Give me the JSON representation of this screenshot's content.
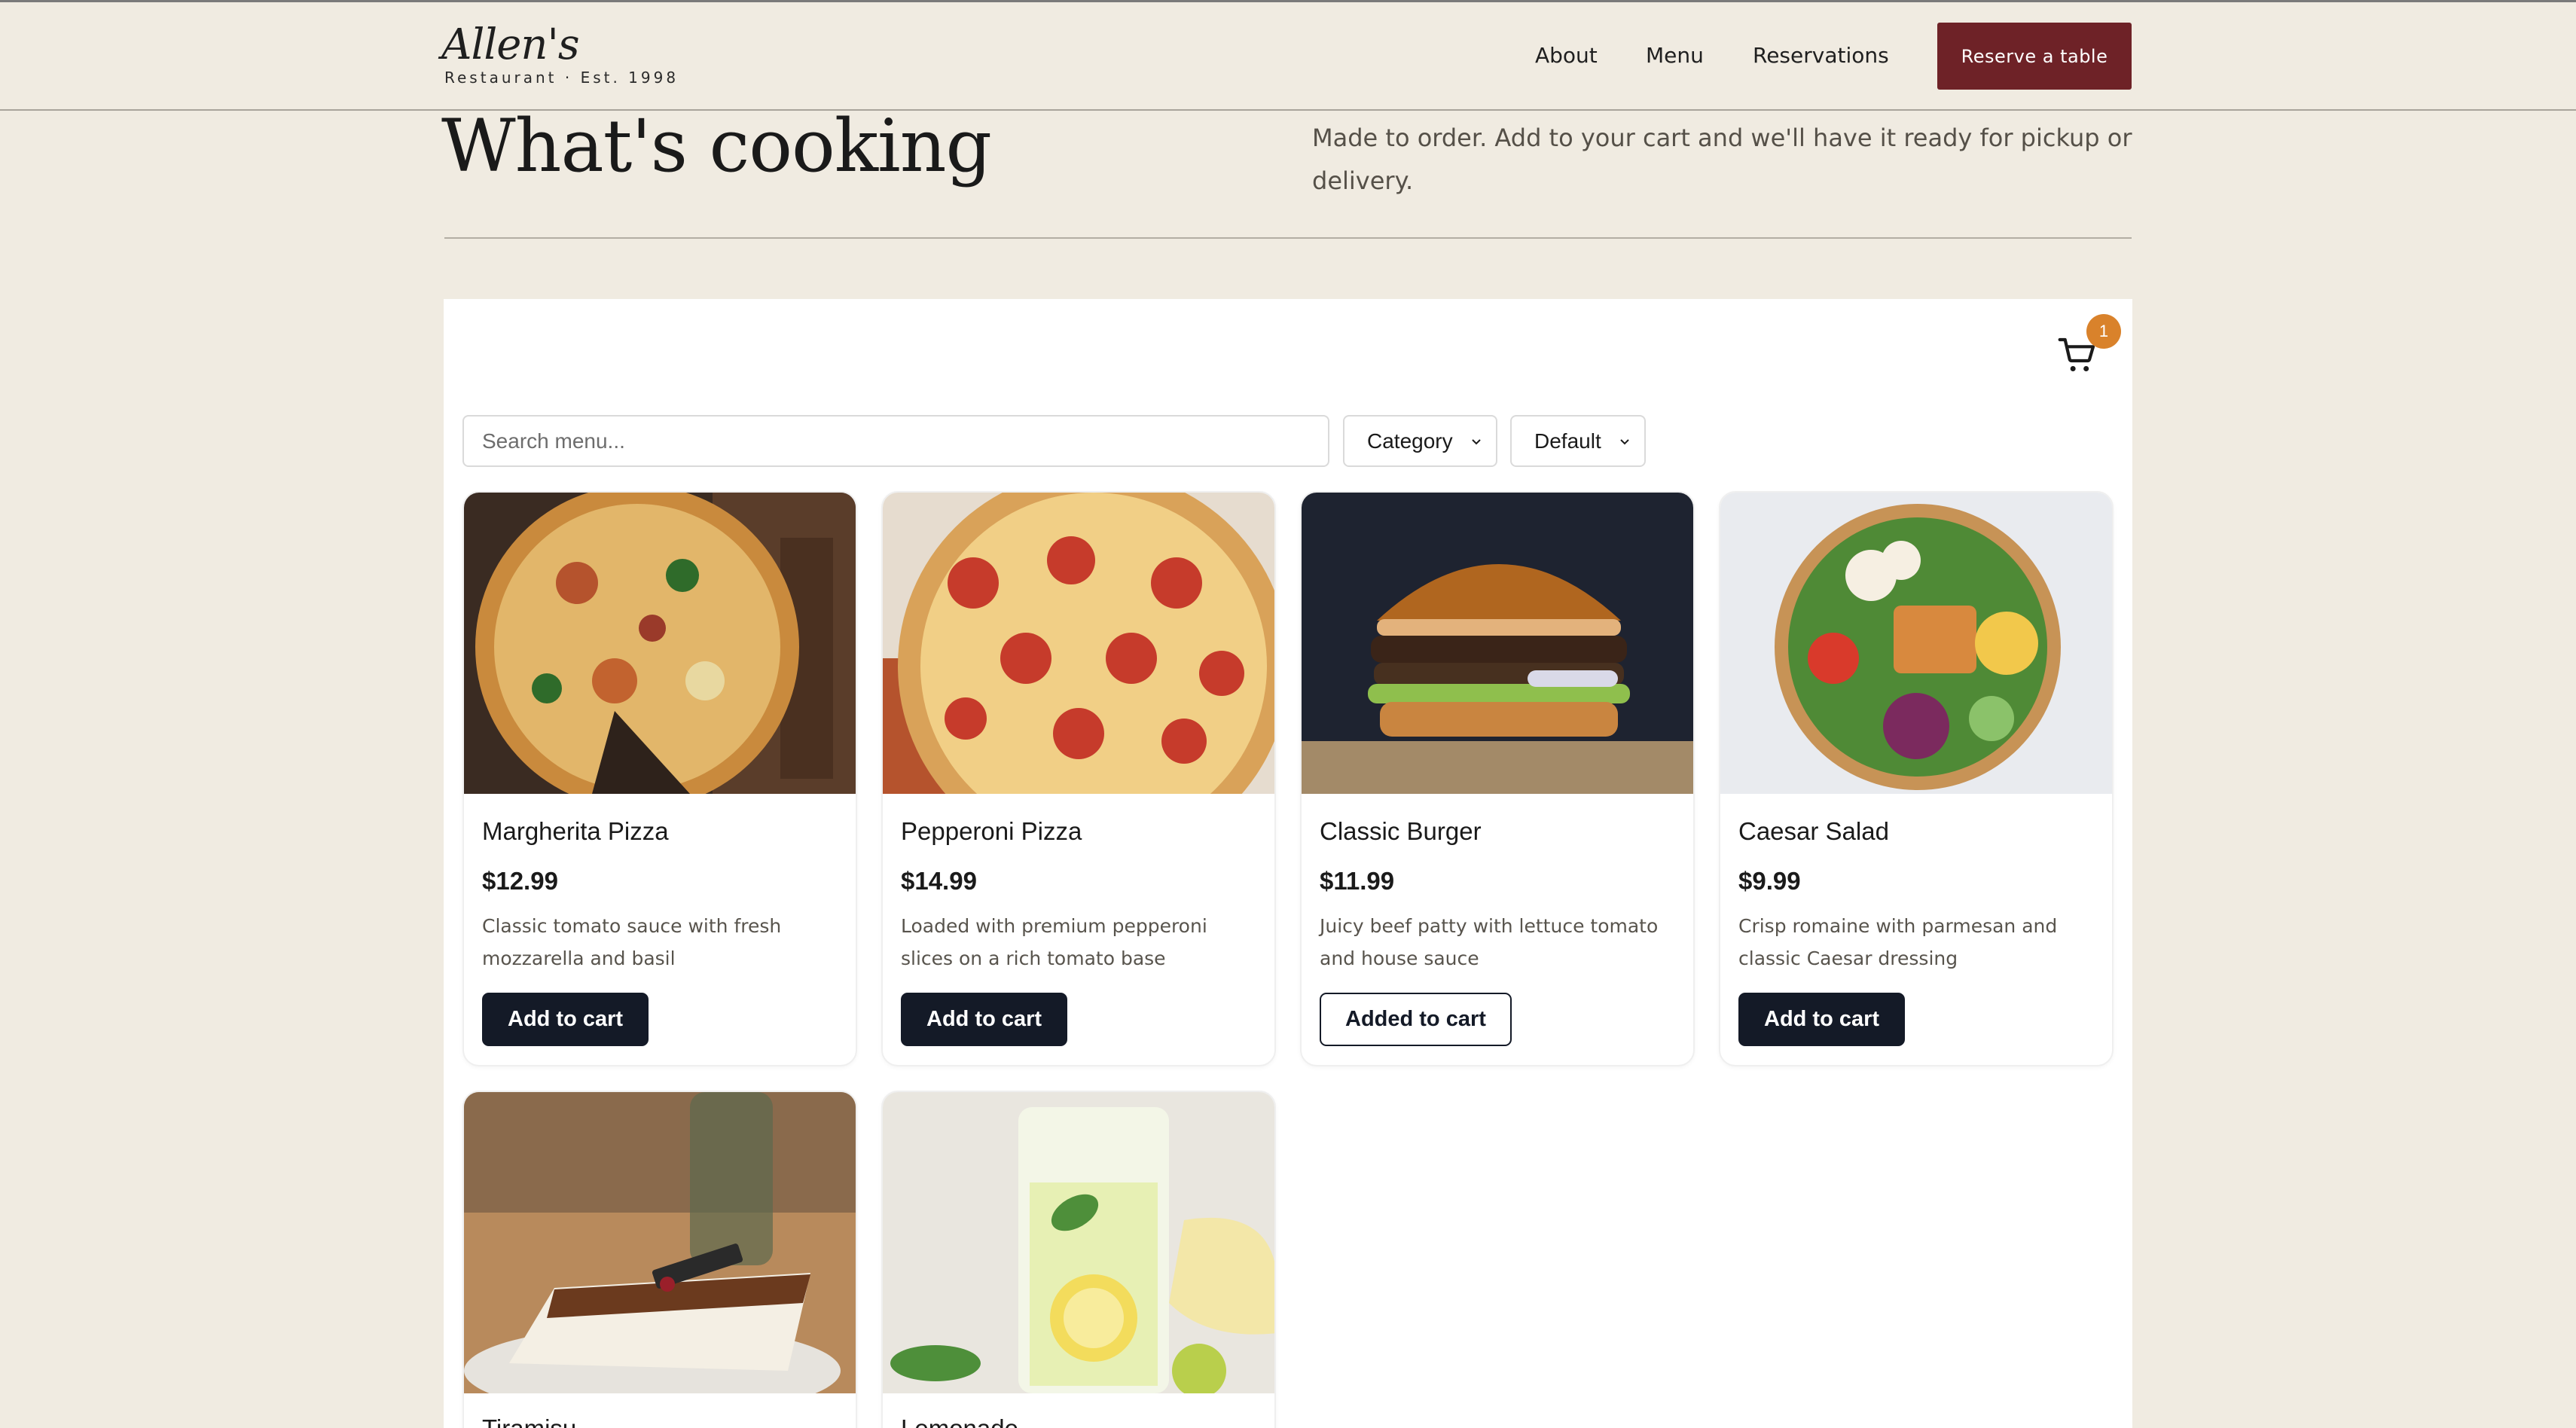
{
  "header": {
    "brand_name": "Allen's",
    "brand_tagline": "Restaurant · Est. 1998",
    "nav": [
      "About",
      "Menu",
      "Reservations"
    ],
    "cta_label": "Reserve a table"
  },
  "hero": {
    "title": "What's cooking",
    "intro": "Made to order. Add to your cart and we'll have it ready for pickup or delivery."
  },
  "toolbar": {
    "search_placeholder": "Search menu...",
    "category_label": "Category",
    "sort_label": "Default"
  },
  "cart": {
    "count": "1",
    "icon": "cart-icon"
  },
  "colors": {
    "accent": "#6e2227",
    "badge": "#d9822b",
    "button": "#141a27",
    "background": "#f0ebe1"
  },
  "menu": [
    {
      "name": "Margherita Pizza",
      "price": "$12.99",
      "description": "Classic tomato sauce with fresh mozzarella and basil",
      "button": "Add to cart",
      "in_cart": false
    },
    {
      "name": "Pepperoni Pizza",
      "price": "$14.99",
      "description": "Loaded with premium pepperoni slices on a rich tomato base",
      "button": "Add to cart",
      "in_cart": false
    },
    {
      "name": "Classic Burger",
      "price": "$11.99",
      "description": "Juicy beef patty with lettuce tomato and house sauce",
      "button": "Added to cart",
      "in_cart": true
    },
    {
      "name": "Caesar Salad",
      "price": "$9.99",
      "description": "Crisp romaine with parmesan and classic Caesar dressing",
      "button": "Add to cart",
      "in_cart": false
    },
    {
      "name": "Tiramisu"
    },
    {
      "name": "Lemonade"
    }
  ]
}
